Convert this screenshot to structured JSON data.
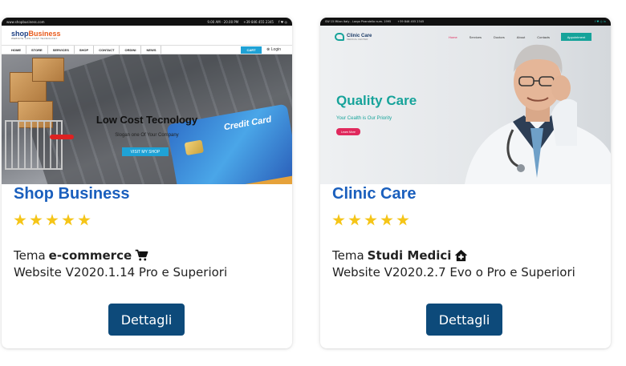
{
  "cards": [
    {
      "title": "Shop Business",
      "rating": 5,
      "theme_prefix": "Tema",
      "theme_name": "e-commerce",
      "theme_icon": "shopping-cart-icon",
      "version": "Website V2020.1.14 Pro e Superiori",
      "button": "Dettagli",
      "preview": {
        "topbar_left": "www.shopbusiness.com",
        "topbar_hours": "9.00 AM - 20.00 PM",
        "topbar_phone": "+39 846 455 2345",
        "topbar_social": "f ♥ ◎",
        "logo_main_1": "shop",
        "logo_main_2": "Business",
        "logo_sub": "WEBSITE LOW COST TECNOLOGY",
        "nav": [
          "HOME",
          "STORE",
          "SERVICES",
          "SHOP",
          "CONTACT",
          "ORDINI",
          "NEWS"
        ],
        "cart": "CART",
        "login": "Login",
        "headline": "Low Cost Tecnology",
        "slogan": "Slogan one Of Your Company",
        "cta": "VISIT MY SHOP",
        "credit_card": "Credit Card"
      }
    },
    {
      "title": "Clinic Care",
      "rating": 5,
      "theme_prefix": "Tema",
      "theme_name": "Studi Medici",
      "theme_icon": "home-medical-icon",
      "version": "Website V2020.2.7 Evo o Pro e Superiori",
      "button": "Dettagli",
      "preview": {
        "topbar_address": "SW 15 Milan Italy - Largo Pirandello num. 1995",
        "topbar_phone": "+39 846 455 2345",
        "topbar_social": "f ♥ ◎ in",
        "logo": "Clinic Care",
        "logo_sub": "MEDICAL CENTER",
        "nav": [
          "Home",
          "Services",
          "Doctors",
          "About",
          "Contacts"
        ],
        "nav_active": "Home",
        "appointment": "Appointment",
        "headline": "Quality Care",
        "subline": "Your Cealth is Our Priority",
        "cta": "Learn More"
      }
    }
  ],
  "colors": {
    "title_blue": "#1a5fbd",
    "button_navy": "#0d4a7a",
    "star_gold": "#f5c518",
    "clinic_teal": "#16a39a",
    "clinic_pink": "#e0295d",
    "shop_cyan": "#1fa2d6"
  }
}
